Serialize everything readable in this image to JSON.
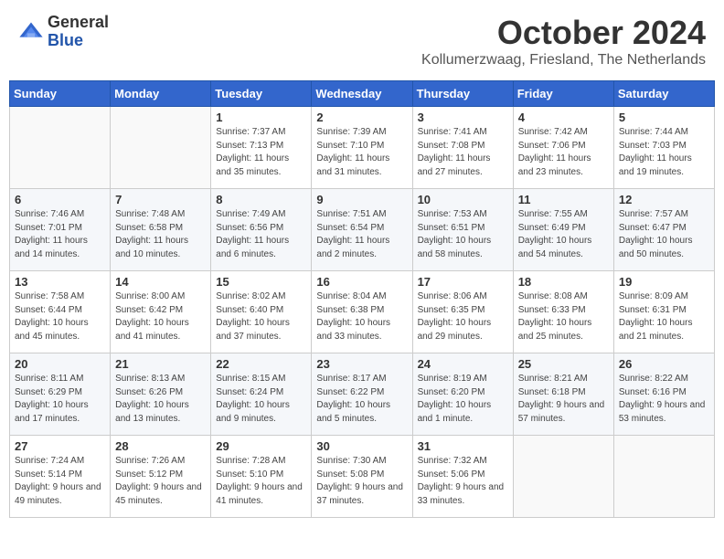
{
  "header": {
    "logo_general": "General",
    "logo_blue": "Blue",
    "month_title": "October 2024",
    "location": "Kollumerzwaag, Friesland, The Netherlands"
  },
  "weekdays": [
    "Sunday",
    "Monday",
    "Tuesday",
    "Wednesday",
    "Thursday",
    "Friday",
    "Saturday"
  ],
  "weeks": [
    [
      {
        "day": "",
        "empty": true
      },
      {
        "day": "",
        "empty": true
      },
      {
        "day": "1",
        "sunrise": "Sunrise: 7:37 AM",
        "sunset": "Sunset: 7:13 PM",
        "daylight": "Daylight: 11 hours and 35 minutes."
      },
      {
        "day": "2",
        "sunrise": "Sunrise: 7:39 AM",
        "sunset": "Sunset: 7:10 PM",
        "daylight": "Daylight: 11 hours and 31 minutes."
      },
      {
        "day": "3",
        "sunrise": "Sunrise: 7:41 AM",
        "sunset": "Sunset: 7:08 PM",
        "daylight": "Daylight: 11 hours and 27 minutes."
      },
      {
        "day": "4",
        "sunrise": "Sunrise: 7:42 AM",
        "sunset": "Sunset: 7:06 PM",
        "daylight": "Daylight: 11 hours and 23 minutes."
      },
      {
        "day": "5",
        "sunrise": "Sunrise: 7:44 AM",
        "sunset": "Sunset: 7:03 PM",
        "daylight": "Daylight: 11 hours and 19 minutes."
      }
    ],
    [
      {
        "day": "6",
        "sunrise": "Sunrise: 7:46 AM",
        "sunset": "Sunset: 7:01 PM",
        "daylight": "Daylight: 11 hours and 14 minutes."
      },
      {
        "day": "7",
        "sunrise": "Sunrise: 7:48 AM",
        "sunset": "Sunset: 6:58 PM",
        "daylight": "Daylight: 11 hours and 10 minutes."
      },
      {
        "day": "8",
        "sunrise": "Sunrise: 7:49 AM",
        "sunset": "Sunset: 6:56 PM",
        "daylight": "Daylight: 11 hours and 6 minutes."
      },
      {
        "day": "9",
        "sunrise": "Sunrise: 7:51 AM",
        "sunset": "Sunset: 6:54 PM",
        "daylight": "Daylight: 11 hours and 2 minutes."
      },
      {
        "day": "10",
        "sunrise": "Sunrise: 7:53 AM",
        "sunset": "Sunset: 6:51 PM",
        "daylight": "Daylight: 10 hours and 58 minutes."
      },
      {
        "day": "11",
        "sunrise": "Sunrise: 7:55 AM",
        "sunset": "Sunset: 6:49 PM",
        "daylight": "Daylight: 10 hours and 54 minutes."
      },
      {
        "day": "12",
        "sunrise": "Sunrise: 7:57 AM",
        "sunset": "Sunset: 6:47 PM",
        "daylight": "Daylight: 10 hours and 50 minutes."
      }
    ],
    [
      {
        "day": "13",
        "sunrise": "Sunrise: 7:58 AM",
        "sunset": "Sunset: 6:44 PM",
        "daylight": "Daylight: 10 hours and 45 minutes."
      },
      {
        "day": "14",
        "sunrise": "Sunrise: 8:00 AM",
        "sunset": "Sunset: 6:42 PM",
        "daylight": "Daylight: 10 hours and 41 minutes."
      },
      {
        "day": "15",
        "sunrise": "Sunrise: 8:02 AM",
        "sunset": "Sunset: 6:40 PM",
        "daylight": "Daylight: 10 hours and 37 minutes."
      },
      {
        "day": "16",
        "sunrise": "Sunrise: 8:04 AM",
        "sunset": "Sunset: 6:38 PM",
        "daylight": "Daylight: 10 hours and 33 minutes."
      },
      {
        "day": "17",
        "sunrise": "Sunrise: 8:06 AM",
        "sunset": "Sunset: 6:35 PM",
        "daylight": "Daylight: 10 hours and 29 minutes."
      },
      {
        "day": "18",
        "sunrise": "Sunrise: 8:08 AM",
        "sunset": "Sunset: 6:33 PM",
        "daylight": "Daylight: 10 hours and 25 minutes."
      },
      {
        "day": "19",
        "sunrise": "Sunrise: 8:09 AM",
        "sunset": "Sunset: 6:31 PM",
        "daylight": "Daylight: 10 hours and 21 minutes."
      }
    ],
    [
      {
        "day": "20",
        "sunrise": "Sunrise: 8:11 AM",
        "sunset": "Sunset: 6:29 PM",
        "daylight": "Daylight: 10 hours and 17 minutes."
      },
      {
        "day": "21",
        "sunrise": "Sunrise: 8:13 AM",
        "sunset": "Sunset: 6:26 PM",
        "daylight": "Daylight: 10 hours and 13 minutes."
      },
      {
        "day": "22",
        "sunrise": "Sunrise: 8:15 AM",
        "sunset": "Sunset: 6:24 PM",
        "daylight": "Daylight: 10 hours and 9 minutes."
      },
      {
        "day": "23",
        "sunrise": "Sunrise: 8:17 AM",
        "sunset": "Sunset: 6:22 PM",
        "daylight": "Daylight: 10 hours and 5 minutes."
      },
      {
        "day": "24",
        "sunrise": "Sunrise: 8:19 AM",
        "sunset": "Sunset: 6:20 PM",
        "daylight": "Daylight: 10 hours and 1 minute."
      },
      {
        "day": "25",
        "sunrise": "Sunrise: 8:21 AM",
        "sunset": "Sunset: 6:18 PM",
        "daylight": "Daylight: 9 hours and 57 minutes."
      },
      {
        "day": "26",
        "sunrise": "Sunrise: 8:22 AM",
        "sunset": "Sunset: 6:16 PM",
        "daylight": "Daylight: 9 hours and 53 minutes."
      }
    ],
    [
      {
        "day": "27",
        "sunrise": "Sunrise: 7:24 AM",
        "sunset": "Sunset: 5:14 PM",
        "daylight": "Daylight: 9 hours and 49 minutes."
      },
      {
        "day": "28",
        "sunrise": "Sunrise: 7:26 AM",
        "sunset": "Sunset: 5:12 PM",
        "daylight": "Daylight: 9 hours and 45 minutes."
      },
      {
        "day": "29",
        "sunrise": "Sunrise: 7:28 AM",
        "sunset": "Sunset: 5:10 PM",
        "daylight": "Daylight: 9 hours and 41 minutes."
      },
      {
        "day": "30",
        "sunrise": "Sunrise: 7:30 AM",
        "sunset": "Sunset: 5:08 PM",
        "daylight": "Daylight: 9 hours and 37 minutes."
      },
      {
        "day": "31",
        "sunrise": "Sunrise: 7:32 AM",
        "sunset": "Sunset: 5:06 PM",
        "daylight": "Daylight: 9 hours and 33 minutes."
      },
      {
        "day": "",
        "empty": true
      },
      {
        "day": "",
        "empty": true
      }
    ]
  ]
}
